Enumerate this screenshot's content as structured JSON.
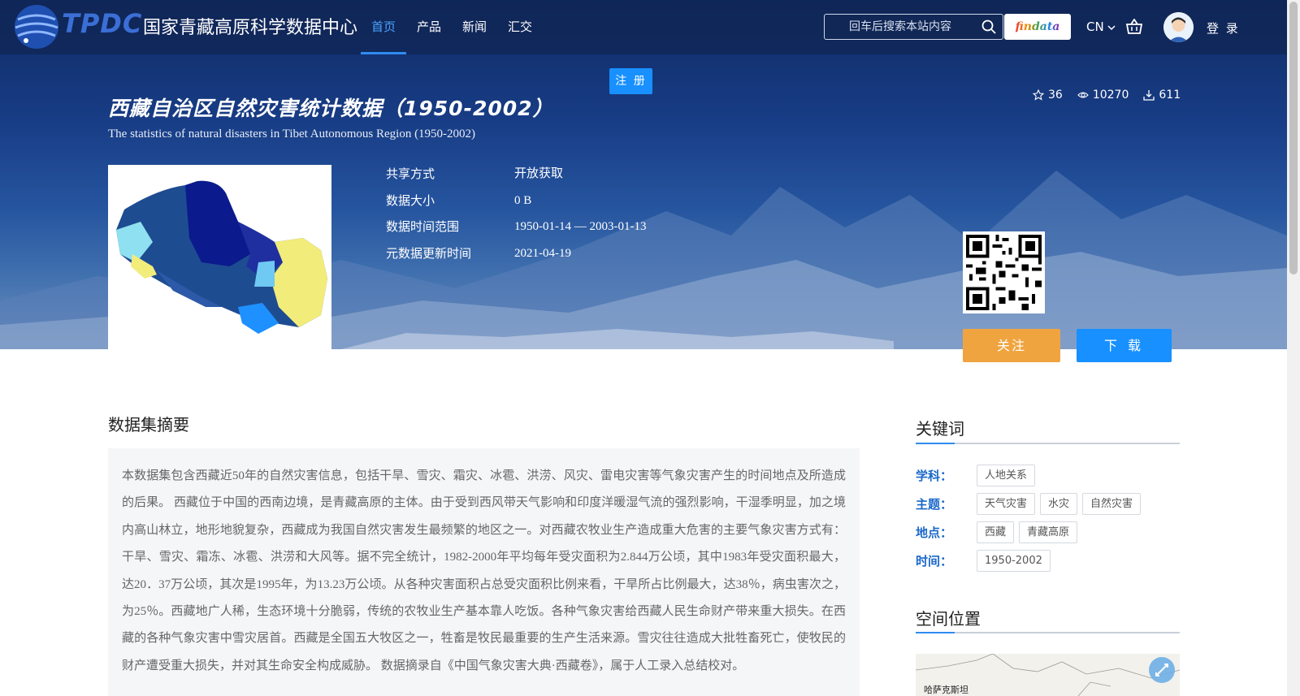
{
  "header": {
    "logo_text": "TPDC",
    "logo_cn": "国家青藏高原科学数据中心",
    "nav": [
      {
        "label": "首页",
        "active": true
      },
      {
        "label": "产品",
        "active": false
      },
      {
        "label": "新闻",
        "active": false
      },
      {
        "label": "汇交",
        "active": false
      }
    ],
    "search_placeholder": "回车后搜索本站内容",
    "findata_label": "findata",
    "lang": "CN",
    "login": "登 录"
  },
  "register_label": "注 册",
  "dataset": {
    "title_cn": "西藏自治区自然灾害统计数据（1950-2002）",
    "title_en": "The statistics of natural disasters in Tibet Autonomous Region (1950-2002)",
    "stats": {
      "stars": "36",
      "views": "10270",
      "downloads": "611"
    },
    "meta": [
      {
        "key": "共享方式",
        "value": "开放获取"
      },
      {
        "key": "数据大小",
        "value": "0 B"
      },
      {
        "key": "数据时间范围",
        "value": "1950-01-14 — 2003-01-13"
      },
      {
        "key": "元数据更新时间",
        "value": "2021-04-19"
      }
    ],
    "follow_label": "关注",
    "download_label": "下 载"
  },
  "summary": {
    "title": "数据集摘要",
    "text": "本数据集包含西藏近50年的自然灾害信息，包括干旱、雪灾、霜灾、冰雹、洪涝、风灾、雷电灾害等气象灾害产生的时间地点及所造成的后果。 西藏位于中国的西南边境，是青藏高原的主体。由于受到西风带天气影响和印度洋暖湿气流的强烈影响，干湿季明显，加之境内高山林立，地形地貌复杂，西藏成为我国自然灾害发生最频繁的地区之一。对西藏农牧业生产造成重大危害的主要气象灾害方式有：干旱、雪灾、霜冻、冰雹、洪涝和大风等。据不完全统计，1982-2000年平均每年受灾面积为2.844万公顷，其中1983年受灾面积最大，达20．37万公顷，其次是1995年，为13.23万公顷。从各种灾害面积占总受灾面积比例来看，干旱所占比例最大，达38％，病虫害次之，为25％。西藏地广人稀，生态环境十分脆弱，传统的农牧业生产基本靠人吃饭。各种气象灾害给西藏人民生命财产带来重大损失。在西藏的各种气象灾害中雪灾居首。西藏是全国五大牧区之一，牲畜是牧民最重要的生产生活来源。雪灾往往造成大批牲畜死亡，使牧民的财产遭受重大损失，并对其生命安全构成威胁。 数据摘录自《中国气象灾害大典·西藏卷》，属于人工录入总结校对。"
  },
  "keywords": {
    "title": "关键词",
    "rows": [
      {
        "label": "学科：",
        "tags": [
          "人地关系"
        ]
      },
      {
        "label": "主题：",
        "tags": [
          "天气灾害",
          "水灾",
          "自然灾害"
        ]
      },
      {
        "label": "地点：",
        "tags": [
          "西藏",
          "青藏高原"
        ]
      },
      {
        "label": "时间：",
        "tags": [
          "1950-2002"
        ]
      }
    ]
  },
  "spatial": {
    "title": "空间位置",
    "map_label": "哈萨克斯坦"
  },
  "colors": {
    "accent": "#1890ff",
    "follow": "#f0a43f",
    "keyword_label": "#1a68c9"
  }
}
